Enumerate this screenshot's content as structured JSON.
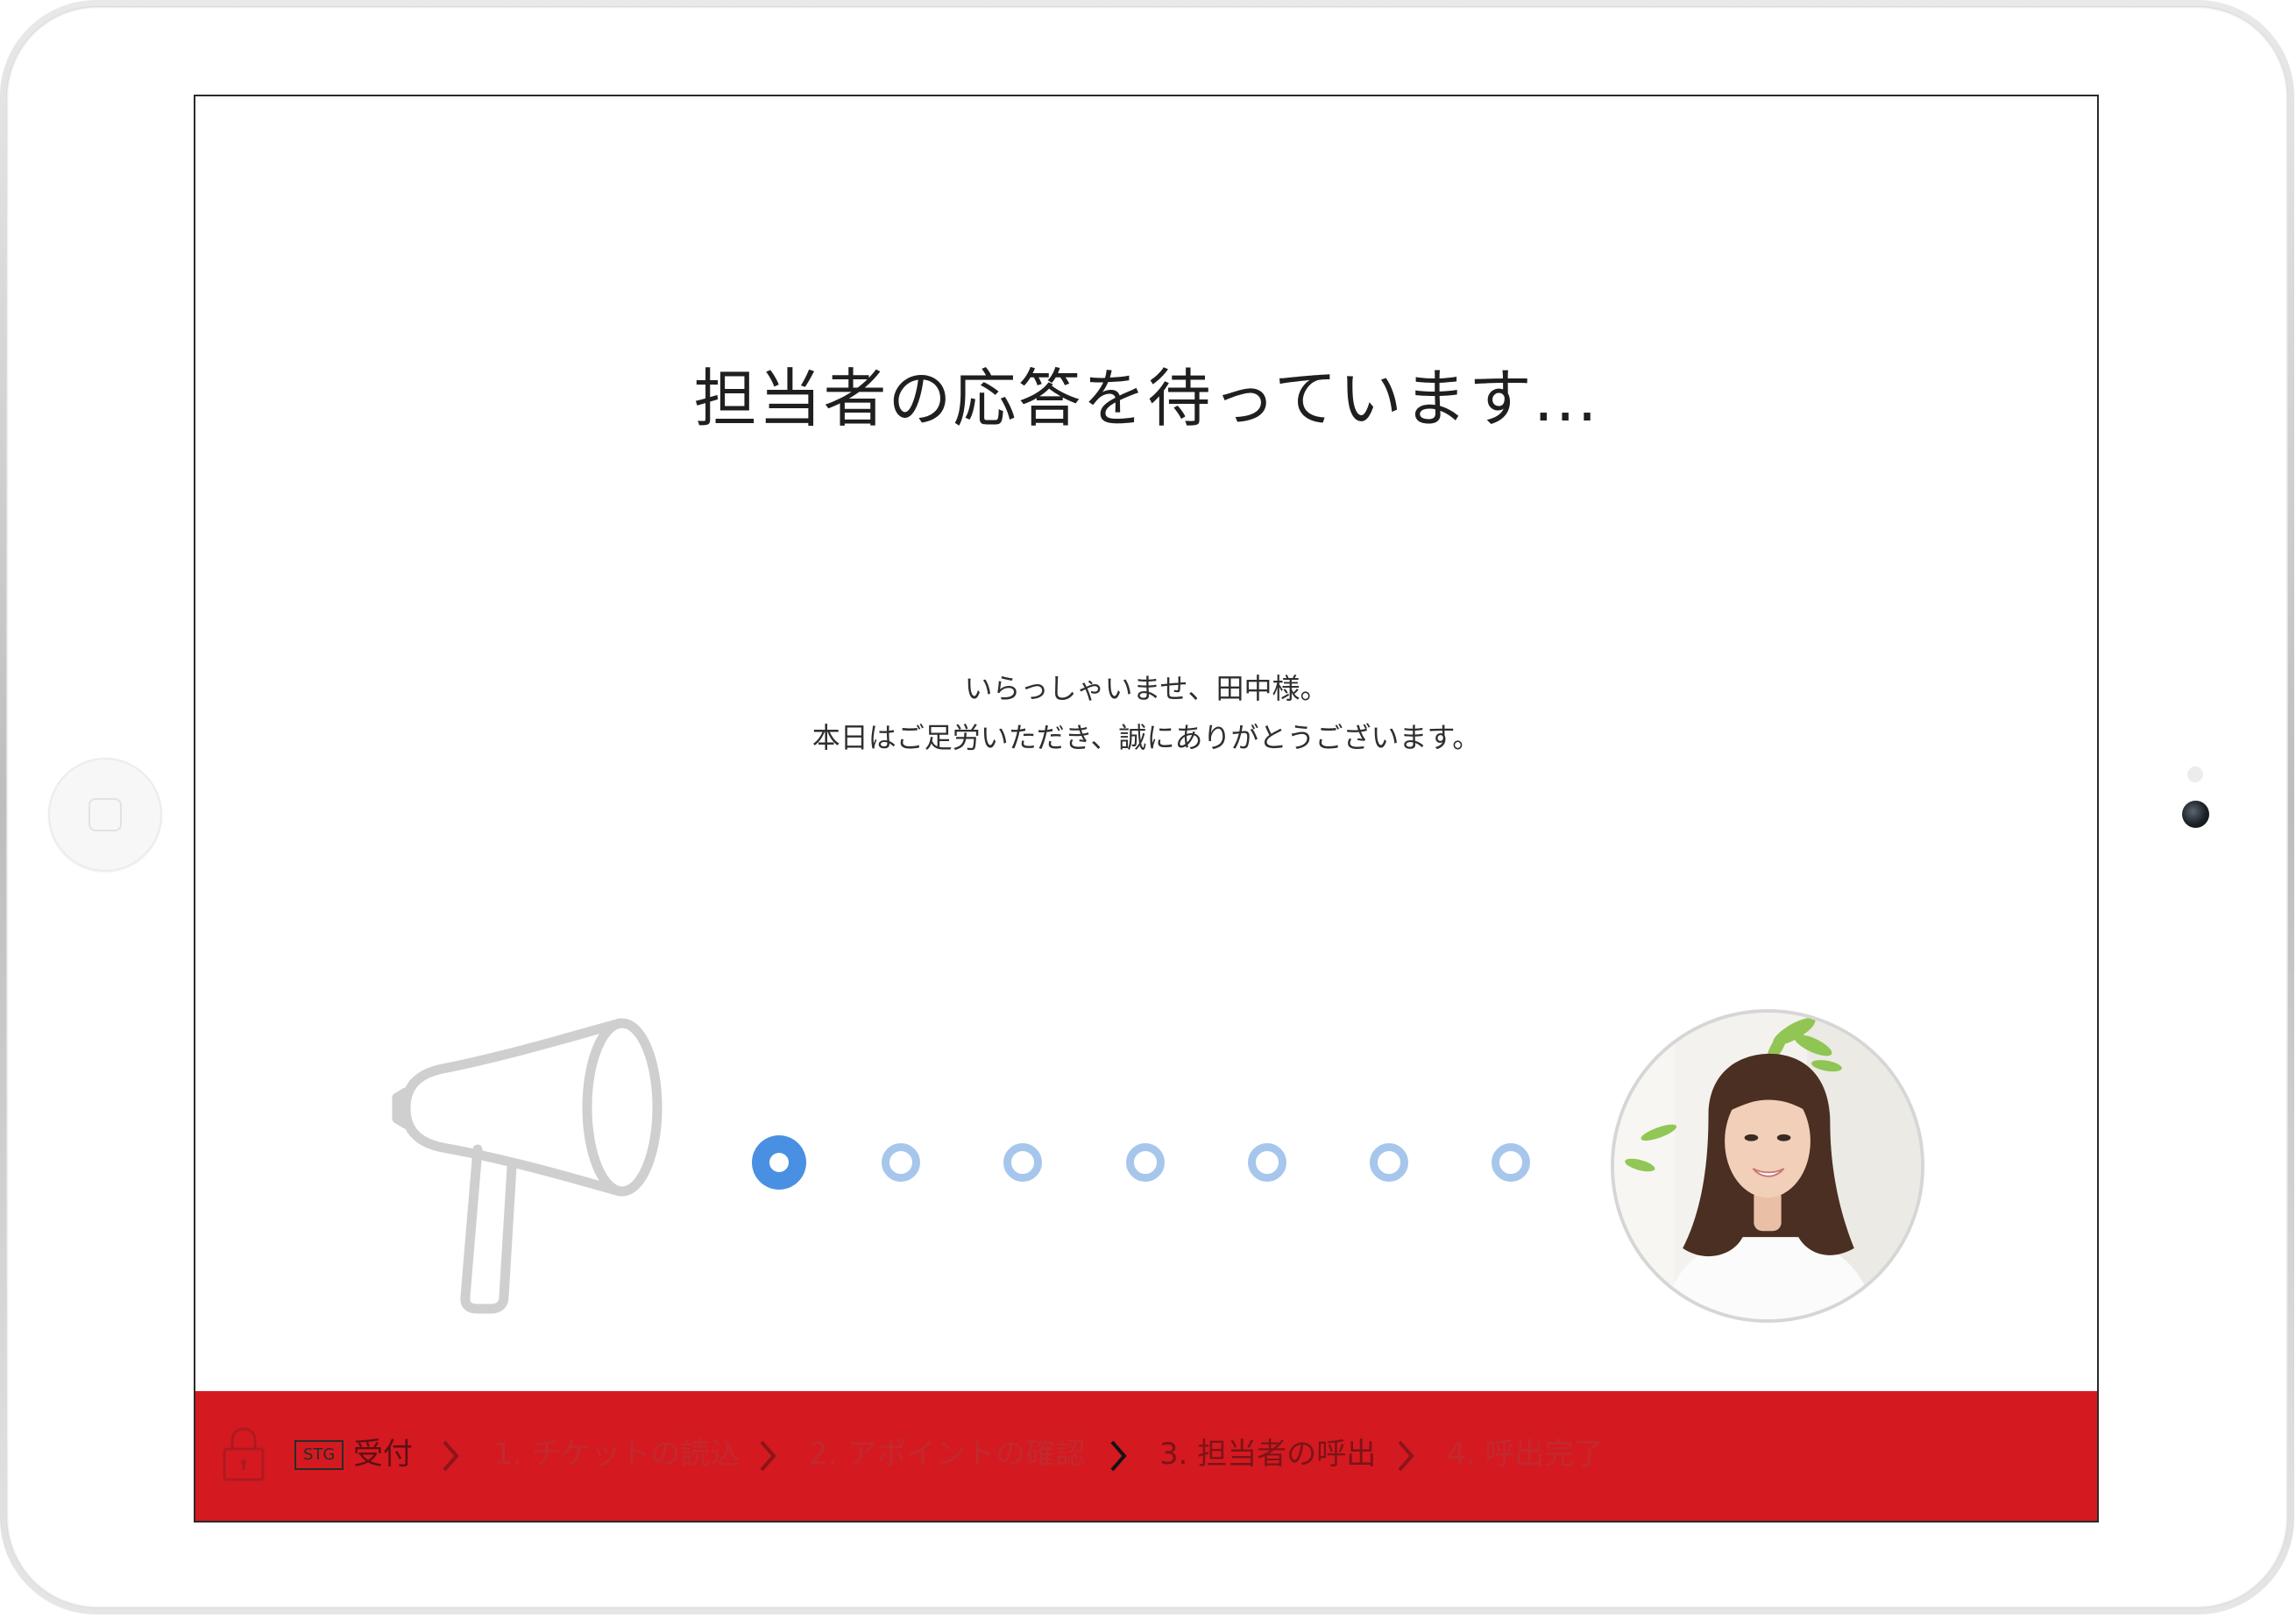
{
  "screen": {
    "title": "担当者の応答を待っています...",
    "greeting": {
      "line1": "いらっしゃいませ、田中様。",
      "line2": "本日はご足労いただき、誠にありがとうございます。"
    },
    "progress": {
      "total_dots": 7,
      "active_index": 0
    },
    "icons": {
      "left": "megaphone-icon",
      "right": "staff-avatar"
    }
  },
  "footer": {
    "env_badge": "STG",
    "section_label": "受付",
    "steps": [
      {
        "label": "1. チケットの読込",
        "state": "done"
      },
      {
        "label": "2. アポイントの確認",
        "state": "done"
      },
      {
        "label": "3. 担当者の呼出",
        "state": "current"
      },
      {
        "label": "4. 呼出完了",
        "state": "upcoming"
      }
    ]
  },
  "colors": {
    "footer_bg": "#d51920",
    "dot_active": "#4a90e2",
    "dot_inactive": "#a7c6ec",
    "icon_gray": "#cfcfcf"
  }
}
